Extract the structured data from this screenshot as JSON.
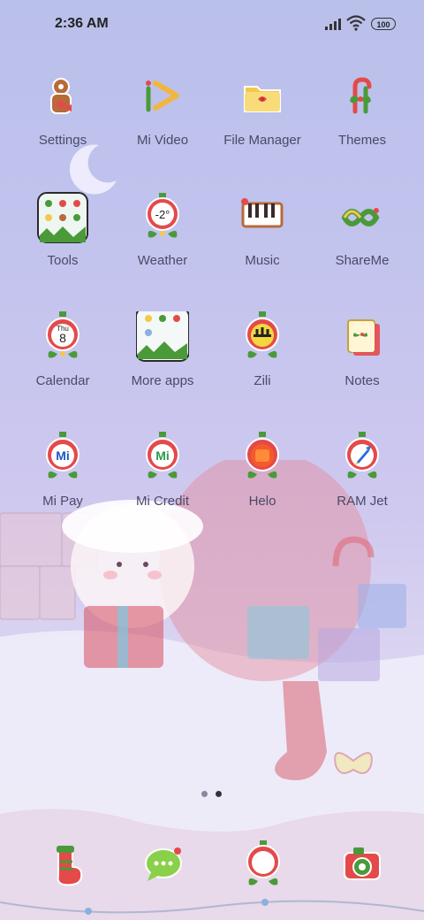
{
  "status_bar": {
    "time": "2:36 AM",
    "battery": "100",
    "icons": [
      "signal-icon",
      "wifi-icon",
      "battery-icon"
    ]
  },
  "apps": [
    {
      "label": "Settings",
      "icon": "gingerbread-gear-icon"
    },
    {
      "label": "Mi Video",
      "icon": "play-icon"
    },
    {
      "label": "File Manager",
      "icon": "folder-icon"
    },
    {
      "label": "Themes",
      "icon": "candy-cane-bow-icon"
    },
    {
      "label": "Tools",
      "icon": "tools-folder-icon"
    },
    {
      "label": "Weather",
      "icon": "weather-ornament-icon",
      "value": "-2°"
    },
    {
      "label": "Music",
      "icon": "piano-icon"
    },
    {
      "label": "ShareMe",
      "icon": "infinity-icon"
    },
    {
      "label": "Calendar",
      "icon": "calendar-ornament-icon",
      "day": "Thu",
      "date": "8"
    },
    {
      "label": "More apps",
      "icon": "more-apps-folder-icon"
    },
    {
      "label": "Zili",
      "icon": "zili-ornament-icon"
    },
    {
      "label": "Notes",
      "icon": "notes-icon"
    },
    {
      "label": "Mi Pay",
      "icon": "mi-pay-ornament-icon",
      "badge": "Mi"
    },
    {
      "label": "Mi Credit",
      "icon": "mi-credit-ornament-icon",
      "badge": "Mi"
    },
    {
      "label": "Helo",
      "icon": "helo-ornament-icon"
    },
    {
      "label": "RAM Jet",
      "icon": "rocket-ornament-icon"
    }
  ],
  "dock": [
    {
      "icon": "phone-stocking-icon"
    },
    {
      "icon": "messages-bubble-icon"
    },
    {
      "icon": "browser-ornament-icon"
    },
    {
      "icon": "camera-icon"
    }
  ],
  "pager": {
    "pages": 2,
    "current": 2
  },
  "colors": {
    "label": "#4a4a66",
    "accent_red": "#e0464a",
    "accent_green": "#4a9a3a"
  }
}
